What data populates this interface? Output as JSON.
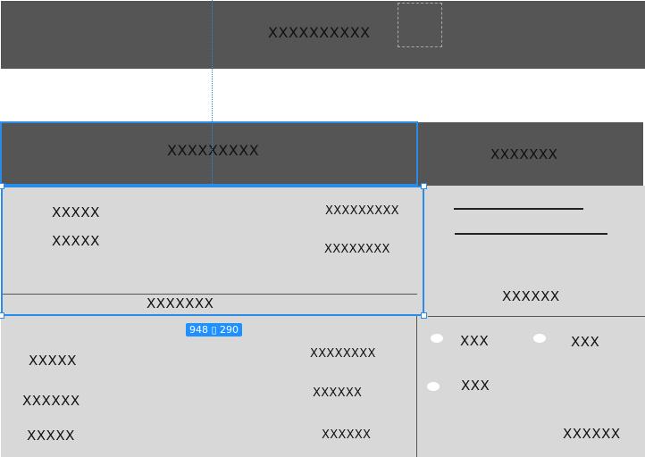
{
  "header": {
    "title": "XXXXXXXXXX"
  },
  "left_panel": {
    "header_title": "XXXXXXXXX",
    "row1_left": "XXXXX",
    "row1_right": "XXXXXXXXX",
    "row2_left": "XXXXX",
    "row2_right": "XXXXXXXX",
    "footer_label": "XXXXXXX"
  },
  "selection": {
    "size_label": "948 ▯ 290"
  },
  "bottom_list": {
    "rows": [
      {
        "left": "XXXXX",
        "right": "XXXXXXXX"
      },
      {
        "left": "XXXXXX",
        "right": "XXXXXX"
      },
      {
        "left": "XXXXX",
        "right": "XXXXXX"
      }
    ]
  },
  "right_panel": {
    "header_title": "XXXXXXX",
    "card_label": "XXXXXX",
    "options": [
      "XXX",
      "XXX",
      "XXX"
    ],
    "footer_label": "XXXXXX"
  },
  "colors": {
    "dark": "#555555",
    "light": "#d8d8d8",
    "selection": "#2a8be8"
  }
}
